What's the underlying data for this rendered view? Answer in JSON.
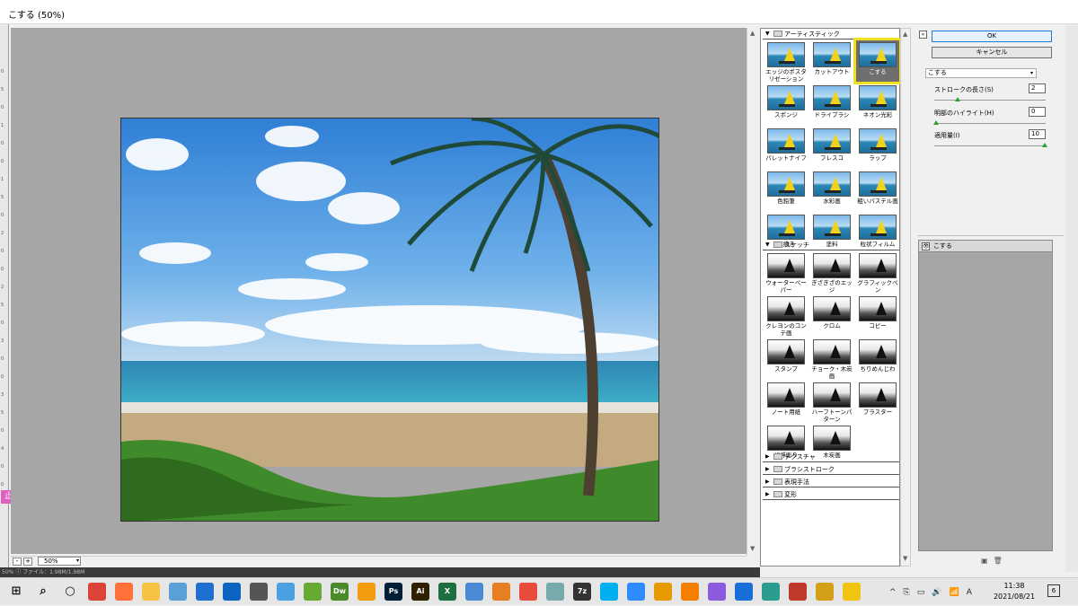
{
  "window": {
    "title": "こする (50%)"
  },
  "ruler_marks": [
    "0",
    "5",
    "0",
    "1",
    "0",
    "0",
    "1",
    "5",
    "0",
    "2",
    "0",
    "0",
    "2",
    "5",
    "0",
    "3",
    "0",
    "0",
    "3",
    "5",
    "0",
    "4",
    "0",
    "0"
  ],
  "ps_tool": "止",
  "zoom": {
    "minus": "-",
    "plus": "+",
    "value": "50%",
    "arrow": "▾"
  },
  "status_text": "50%   ⓘ   ファイル：1.98M/1.98M",
  "gallery": {
    "artistic": {
      "label": "アーティスティック",
      "items": [
        "エッジのポスタリゼーション",
        "カットアウト",
        "こする",
        "スポンジ",
        "ドライブラシ",
        "ネオン光彩",
        "パレットナイフ",
        "フレスコ",
        "ラップ",
        "色鉛筆",
        "水彩画",
        "粗いパステル画",
        "粗描き",
        "塗料",
        "粒状フィルム"
      ]
    },
    "sketch": {
      "label": "スケッチ",
      "items": [
        "ウォーターペーパー",
        "ぎざぎざのエッジ",
        "グラフィックペン",
        "クレヨンのコンテ画",
        "クロム",
        "コピー",
        "スタンプ",
        "チョーク・木炭画",
        "ちりめんじわ",
        "ノート用紙",
        "ハーフトーンパターン",
        "プラスター",
        "浅浮彫り",
        "木炭画"
      ]
    },
    "collapsed": [
      "テクスチャ",
      "ブラシストローク",
      "表現手法",
      "変形"
    ]
  },
  "buttons": {
    "ok": "OK",
    "cancel": "キャンセル"
  },
  "filter_select": {
    "value": "こする",
    "arrow": "▾"
  },
  "params": [
    {
      "label": "ストロークの長さ(S)",
      "value": "2",
      "fraction": 0.2
    },
    {
      "label": "明部のハイライト(H)",
      "value": "0",
      "fraction": 0.0
    },
    {
      "label": "適用量(I)",
      "value": "10",
      "fraction": 1.0
    }
  ],
  "layer": {
    "name": "こする",
    "eye": "👁"
  },
  "icons": {
    "collapse": "collapse-icon",
    "new_layer": "new-effect-layer-icon",
    "delete": "trash-icon"
  },
  "taskbar": {
    "apps": [
      "start",
      "search",
      "cortana",
      "chrome",
      "firefox",
      "explorer",
      "tablet",
      "photos",
      "outlook",
      "settings",
      "news",
      "winrar",
      "Dw",
      "sublime",
      "Ps",
      "Ai",
      "X",
      "editor",
      "butterfly",
      "paint",
      "feather",
      "7z",
      "skype",
      "zoom",
      "player",
      "vlc",
      "dragon",
      "music",
      "globe",
      "record",
      "cat",
      "sticky"
    ],
    "tray": [
      "^",
      "⎘",
      "▭",
      "🔊",
      "📶",
      "A"
    ],
    "time": "11:38",
    "date": "2021/08/21",
    "notification_count": "6"
  },
  "colors": {
    "selection_outline": "#f0e020",
    "preview_bg": "#a6a6a6",
    "ok_border": "#1e7bd6"
  }
}
